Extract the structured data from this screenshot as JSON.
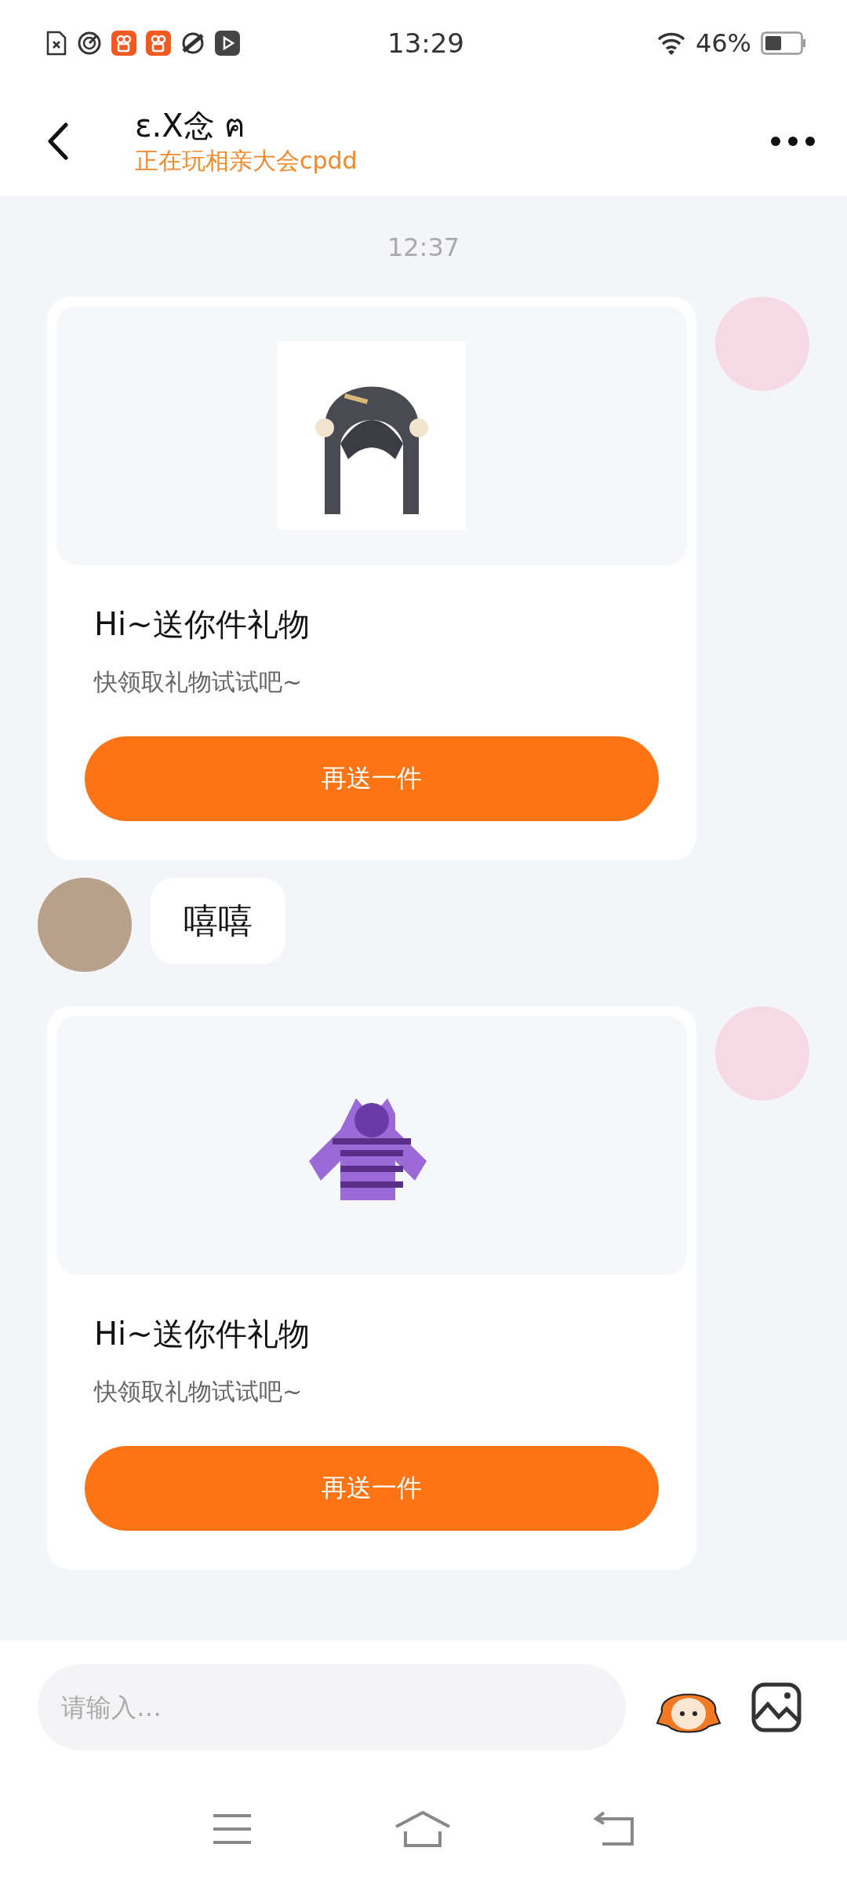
{
  "status_bar": {
    "time": "13:29",
    "battery": "46%"
  },
  "header": {
    "name": "ɛ.X念 ฅ",
    "status": "正在玩相亲大会cpdd"
  },
  "timestamp": "12:37",
  "messages": [
    {
      "kind": "hair",
      "outgoing": true,
      "title": "Hi~送你件礼物",
      "subtitle": "快领取礼物试试吧~",
      "button": "再送一件"
    },
    {
      "kind": "text",
      "outgoing": false,
      "text": "嘻嘻"
    },
    {
      "kind": "hoodie",
      "outgoing": true,
      "title": "Hi~送你件礼物",
      "subtitle": "快领取礼物试试吧~",
      "button": "再送一件"
    }
  ],
  "input": {
    "placeholder": "请输入…"
  }
}
